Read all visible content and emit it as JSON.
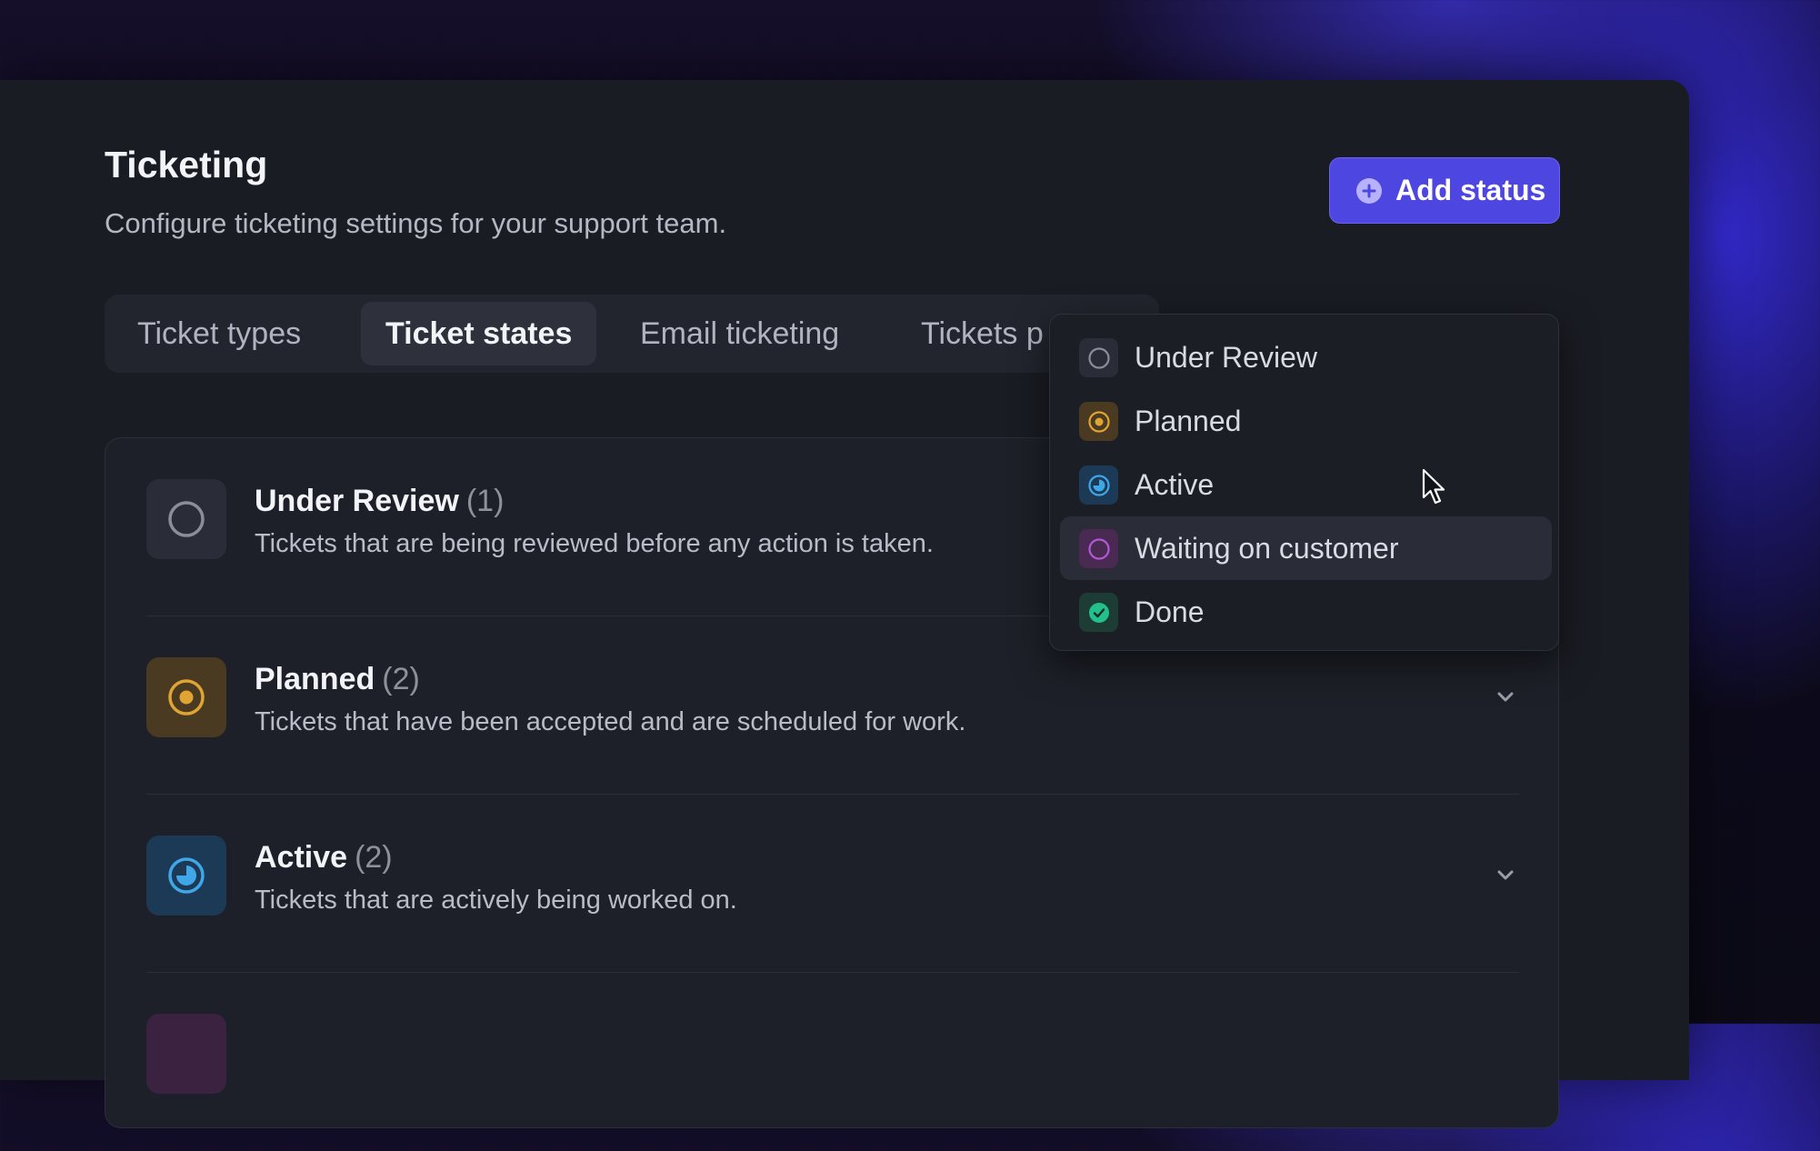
{
  "header": {
    "title": "Ticketing",
    "subtitle": "Configure ticketing settings for your support team."
  },
  "add_status_button": {
    "label": "Add status",
    "icon": "plus-circle-icon"
  },
  "tabs": [
    {
      "label": "Ticket types",
      "active": false
    },
    {
      "label": "Ticket states",
      "active": true
    },
    {
      "label": "Email ticketing",
      "active": false
    },
    {
      "label": "Tickets p",
      "active": false
    }
  ],
  "states": [
    {
      "name": "Under Review",
      "count": "(1)",
      "description": "Tickets that are being reviewed before any action is taken.",
      "icon": "empty-circle-icon",
      "color": "#8a8e99"
    },
    {
      "name": "Planned",
      "count": "(2)",
      "description": "Tickets that have been accepted and are scheduled for work.",
      "icon": "target-circle-icon",
      "color": "#e0a432"
    },
    {
      "name": "Active",
      "count": "(2)",
      "description": "Tickets that are actively being worked on.",
      "icon": "half-pie-circle-icon",
      "color": "#3fa7e8"
    }
  ],
  "dropdown": {
    "items": [
      {
        "label": "Under Review",
        "icon": "empty-circle-icon",
        "color": "#8a8e99"
      },
      {
        "label": "Planned",
        "icon": "target-circle-icon",
        "color": "#e0a432"
      },
      {
        "label": "Active",
        "icon": "half-pie-circle-icon",
        "color": "#3fa7e8"
      },
      {
        "label": "Waiting on customer",
        "icon": "circle-icon",
        "color": "#b25ad6",
        "hovered": true
      },
      {
        "label": "Done",
        "icon": "check-circle-icon",
        "color": "#22c08a"
      }
    ]
  },
  "colors": {
    "accent": "#4e46e0",
    "panel": "#1a1c23"
  }
}
